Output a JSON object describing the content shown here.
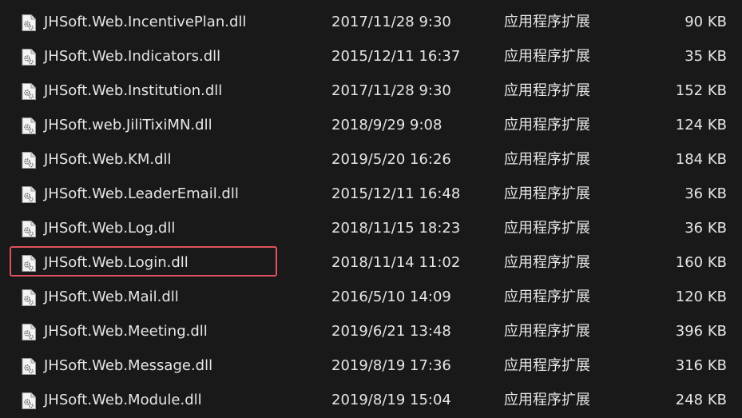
{
  "files": [
    {
      "name": "JHSoft.Web.IncentivePlan.dll",
      "date": "2017/11/28 9:30",
      "type": "应用程序扩展",
      "size": "90 KB",
      "icon": "dll-file-icon"
    },
    {
      "name": "JHSoft.Web.Indicators.dll",
      "date": "2015/12/11 16:37",
      "type": "应用程序扩展",
      "size": "35 KB",
      "icon": "dll-file-icon"
    },
    {
      "name": "JHSoft.Web.Institution.dll",
      "date": "2017/11/28 9:30",
      "type": "应用程序扩展",
      "size": "152 KB",
      "icon": "dll-file-icon"
    },
    {
      "name": "JHSoft.web.JiliTixiMN.dll",
      "date": "2018/9/29 9:08",
      "type": "应用程序扩展",
      "size": "124 KB",
      "icon": "dll-file-icon"
    },
    {
      "name": "JHSoft.Web.KM.dll",
      "date": "2019/5/20 16:26",
      "type": "应用程序扩展",
      "size": "184 KB",
      "icon": "dll-file-icon"
    },
    {
      "name": "JHSoft.Web.LeaderEmail.dll",
      "date": "2015/12/11 16:48",
      "type": "应用程序扩展",
      "size": "36 KB",
      "icon": "dll-file-icon"
    },
    {
      "name": "JHSoft.Web.Log.dll",
      "date": "2018/11/15 18:23",
      "type": "应用程序扩展",
      "size": "36 KB",
      "icon": "dll-file-icon"
    },
    {
      "name": "JHSoft.Web.Login.dll",
      "date": "2018/11/14 11:02",
      "type": "应用程序扩展",
      "size": "160 KB",
      "icon": "dll-file-icon"
    },
    {
      "name": "JHSoft.Web.Mail.dll",
      "date": "2016/5/10 14:09",
      "type": "应用程序扩展",
      "size": "120 KB",
      "icon": "dll-file-icon"
    },
    {
      "name": "JHSoft.Web.Meeting.dll",
      "date": "2019/6/21 13:48",
      "type": "应用程序扩展",
      "size": "396 KB",
      "icon": "dll-file-icon"
    },
    {
      "name": "JHSoft.Web.Message.dll",
      "date": "2019/8/19 17:36",
      "type": "应用程序扩展",
      "size": "316 KB",
      "icon": "dll-file-icon"
    },
    {
      "name": "JHSoft.Web.Module.dll",
      "date": "2019/8/19 15:04",
      "type": "应用程序扩展",
      "size": "248 KB",
      "icon": "dll-file-icon"
    }
  ],
  "highlight": {
    "file_index": 7,
    "color": "#e0505e"
  },
  "colors": {
    "background": "#191919",
    "text": "#e6e6e6"
  }
}
